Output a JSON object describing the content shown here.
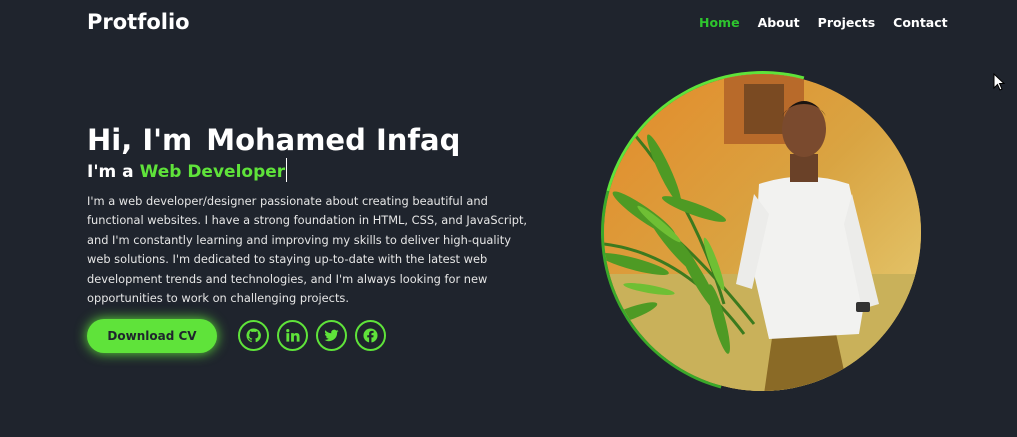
{
  "header": {
    "logo": "Protfolio",
    "nav": [
      {
        "label": "Home",
        "active": true
      },
      {
        "label": "About",
        "active": false
      },
      {
        "label": "Projects",
        "active": false
      },
      {
        "label": "Contact",
        "active": false
      }
    ]
  },
  "hero": {
    "greeting": "Hi, I'm",
    "name": "Mohamed Infaq",
    "role_prefix": "I'm a",
    "role": "Web Developer",
    "description": "I'm a web developer/designer passionate about creating beautiful and functional websites. I have a strong foundation in HTML, CSS, and JavaScript, and I'm constantly learning and improving my skills to deliver high-quality web solutions. I'm dedicated to staying up-to-date with the latest web development trends and technologies, and I'm always looking for new opportunities to work on challenging projects."
  },
  "actions": {
    "download_cv": "Download CV",
    "socials": [
      "github-icon",
      "linkedin-icon",
      "twitter-icon",
      "facebook-icon"
    ]
  },
  "colors": {
    "background": "#1f242d",
    "accent": "#5fe33a",
    "nav_active": "#2ec52e",
    "text": "#ffffff"
  }
}
